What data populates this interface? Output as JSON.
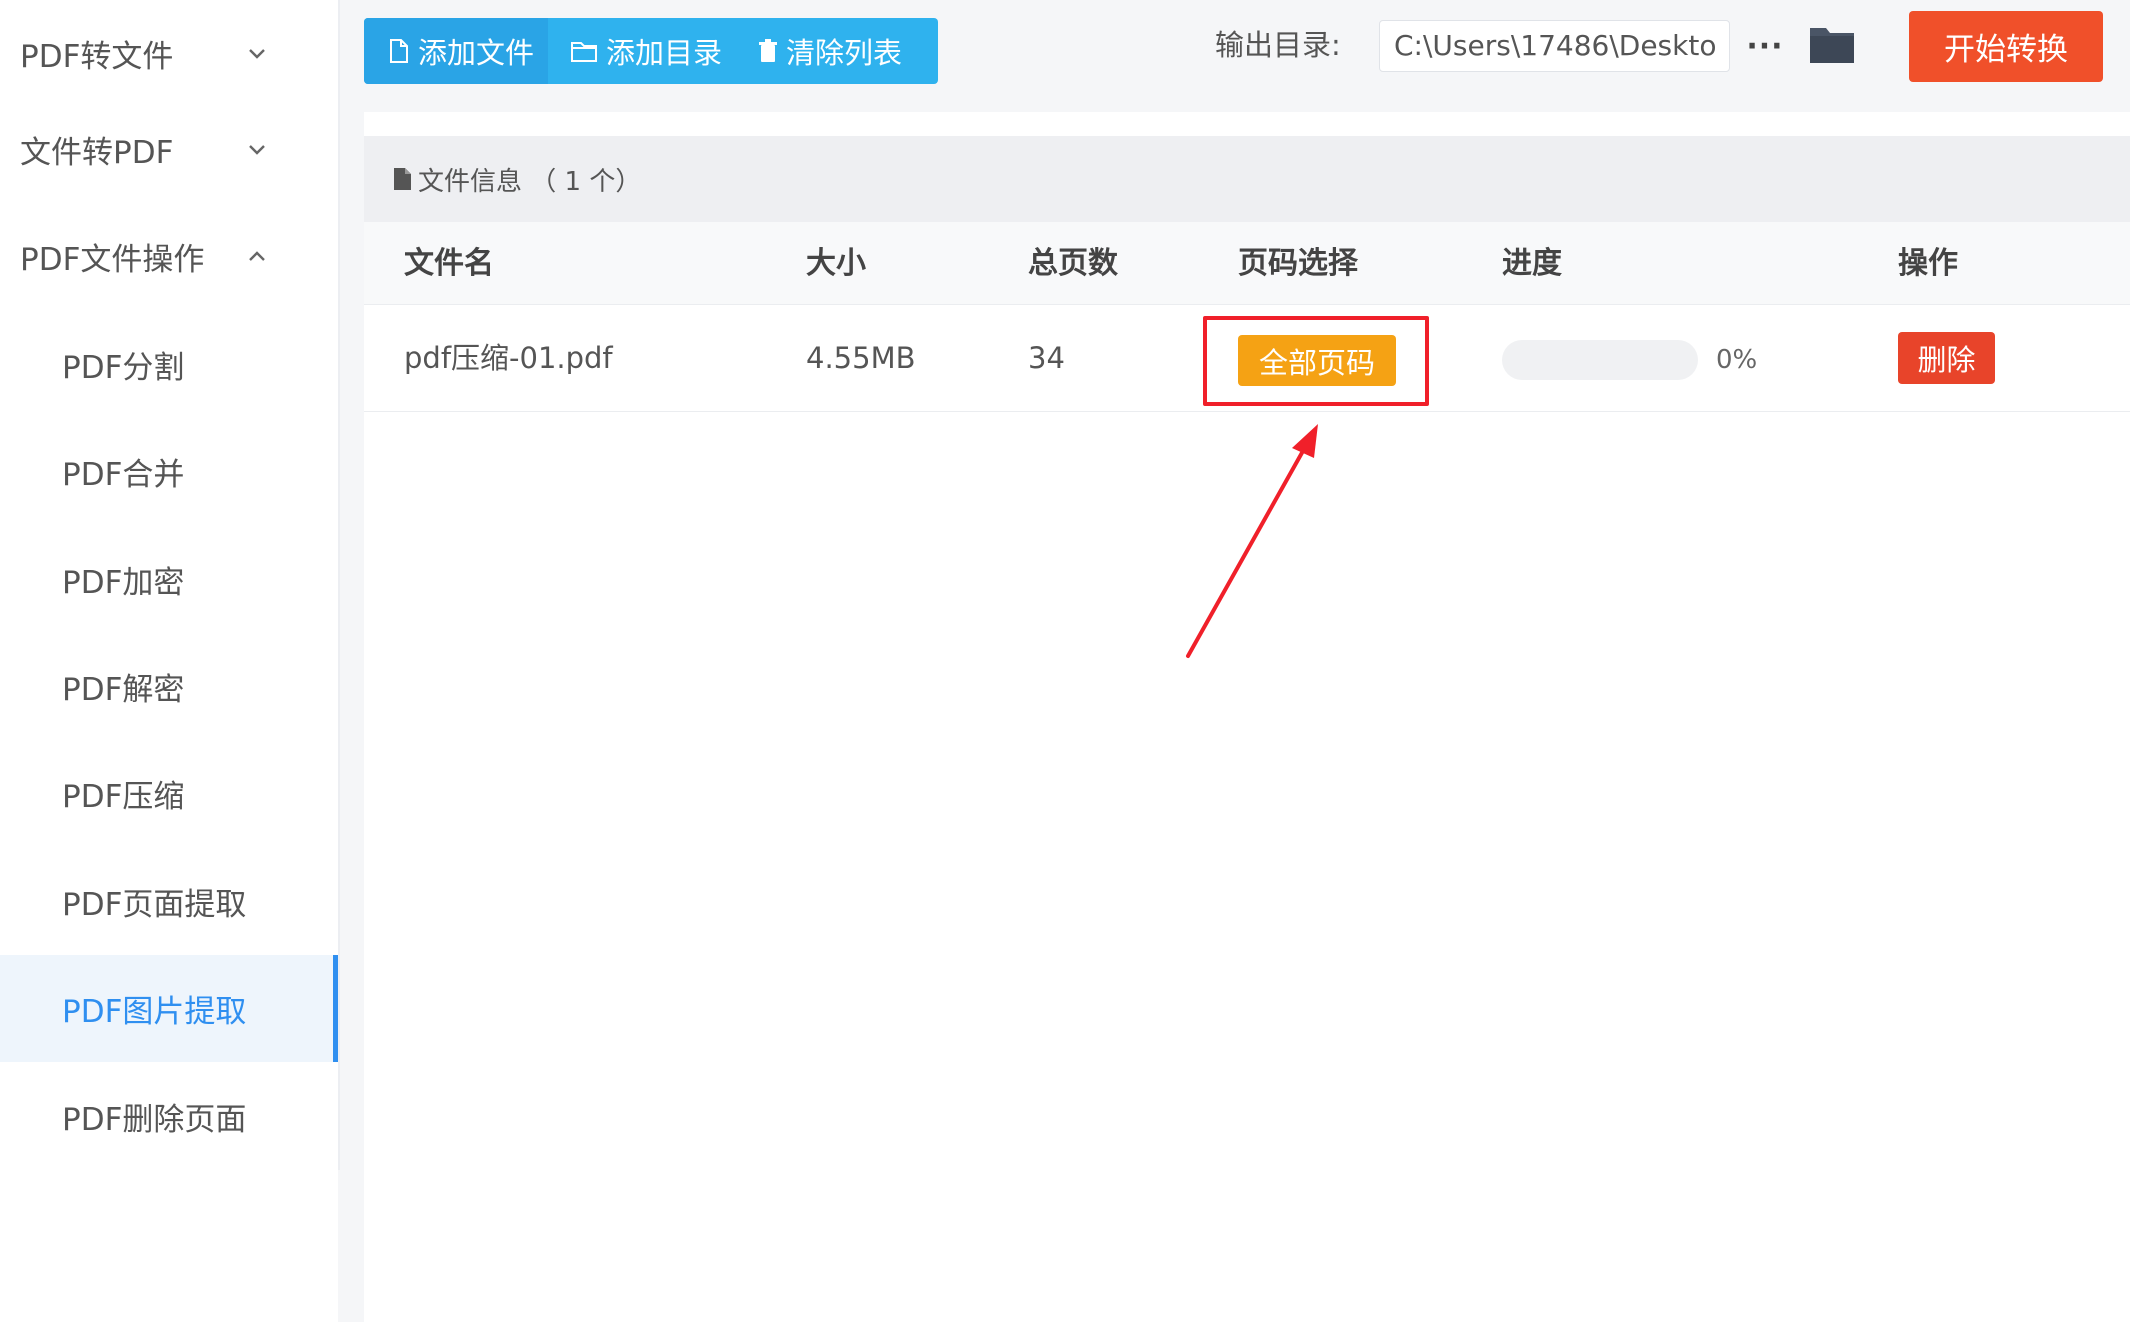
{
  "sidebar": {
    "groups": [
      {
        "label": "PDF转文件",
        "expanded": false
      },
      {
        "label": "文件转PDF",
        "expanded": false
      },
      {
        "label": "PDF文件操作",
        "expanded": true
      }
    ],
    "items": [
      {
        "label": "PDF分割"
      },
      {
        "label": "PDF合并"
      },
      {
        "label": "PDF加密"
      },
      {
        "label": "PDF解密"
      },
      {
        "label": "PDF压缩"
      },
      {
        "label": "PDF页面提取"
      },
      {
        "label": "PDF图片提取",
        "active": true
      },
      {
        "label": "PDF删除页面"
      }
    ]
  },
  "toolbar": {
    "add_file_label": "添加文件",
    "add_dir_label": "添加目录",
    "clear_list_label": "清除列表",
    "output_label": "输出目录:",
    "output_path": "C:\\Users\\17486\\Deskto",
    "more_label": "···",
    "start_label": "开始转换",
    "icons": [
      "file-icon",
      "folder-outline-icon",
      "trash-icon",
      "folder-icon"
    ]
  },
  "file_panel": {
    "info_label": "文件信息 （ 1 个）",
    "columns": {
      "name": "文件名",
      "size": "大小",
      "pages": "总页数",
      "page_select": "页码选择",
      "progress": "进度",
      "action": "操作"
    },
    "rows": [
      {
        "name": "pdf压缩-01.pdf",
        "size": "4.55MB",
        "pages": "34",
        "page_select": "全部页码",
        "progress": 0,
        "progress_text": "0%",
        "action": "删除"
      }
    ]
  },
  "colors": {
    "accent_blue": "#2fb2ee",
    "start_orange": "#f0502a",
    "page_select_orange": "#f5a214",
    "delete_red": "#e8442a",
    "highlight_red": "#f0202a",
    "active_blue": "#2f8ff0"
  }
}
